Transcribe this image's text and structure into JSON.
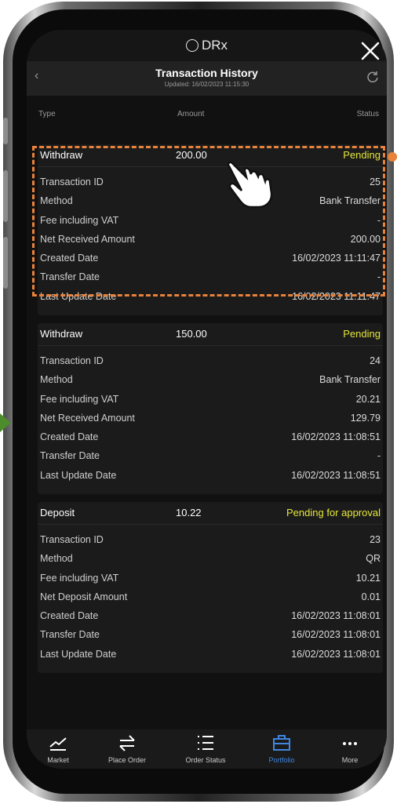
{
  "app": {
    "brand": "DRx"
  },
  "header": {
    "title": "Transaction History",
    "updated": "Updated: 16/02/2023 11:15:30"
  },
  "columns": {
    "type": "Type",
    "amount": "Amount",
    "status": "Status"
  },
  "transactions": [
    {
      "type": "Withdraw",
      "amount": "200.00",
      "status": "Pending",
      "fields": [
        {
          "label": "Transaction ID",
          "value": "25"
        },
        {
          "label": "Method",
          "value": "Bank Transfer"
        },
        {
          "label": "Fee including VAT",
          "value": "-"
        },
        {
          "label": "Net Received Amount",
          "value": "200.00"
        },
        {
          "label": "Created Date",
          "value": "16/02/2023 11:11:47"
        },
        {
          "label": "Transfer Date",
          "value": "-"
        },
        {
          "label": "Last Update Date",
          "value": "16/02/2023 11:11:47"
        }
      ]
    },
    {
      "type": "Withdraw",
      "amount": "150.00",
      "status": "Pending",
      "fields": [
        {
          "label": "Transaction ID",
          "value": "24"
        },
        {
          "label": "Method",
          "value": "Bank Transfer"
        },
        {
          "label": "Fee including VAT",
          "value": "20.21"
        },
        {
          "label": "Net Received Amount",
          "value": "129.79"
        },
        {
          "label": "Created Date",
          "value": "16/02/2023 11:08:51"
        },
        {
          "label": "Transfer Date",
          "value": "-"
        },
        {
          "label": "Last Update Date",
          "value": "16/02/2023 11:08:51"
        }
      ]
    },
    {
      "type": "Deposit",
      "amount": "10.22",
      "status": "Pending for approval",
      "fields": [
        {
          "label": "Transaction ID",
          "value": "23"
        },
        {
          "label": "Method",
          "value": "QR"
        },
        {
          "label": "Fee including VAT",
          "value": "10.21"
        },
        {
          "label": "Net Deposit Amount",
          "value": "0.01"
        },
        {
          "label": "Created Date",
          "value": "16/02/2023 11:08:01"
        },
        {
          "label": "Transfer Date",
          "value": "16/02/2023 11:08:01"
        },
        {
          "label": "Last Update Date",
          "value": "16/02/2023 11:08:01"
        }
      ]
    }
  ],
  "tabs": [
    {
      "label": "Market",
      "icon": "chart-line-icon"
    },
    {
      "label": "Place Order",
      "icon": "swap-arrows-icon"
    },
    {
      "label": "Order Status",
      "icon": "list-icon"
    },
    {
      "label": "Portfolio",
      "icon": "briefcase-icon",
      "active": true
    },
    {
      "label": "More",
      "icon": "more-dots-icon"
    }
  ],
  "colors": {
    "pending": "#e6e63c",
    "active_tab": "#3f86e0",
    "highlight": "#e9823a",
    "arrow": "#4c8c2b"
  }
}
